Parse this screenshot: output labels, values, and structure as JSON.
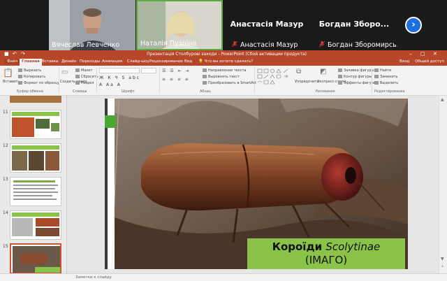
{
  "participants": [
    {
      "name": "Вячеслав Левченко",
      "video": true
    },
    {
      "name": "Наталія Пузріна",
      "video": true
    },
    {
      "name": "Анастасія Мазур",
      "video": false
    },
    {
      "name": "Богдан Збороми...",
      "full_name": "Богдан Збороми...",
      "video": false
    }
  ],
  "participants_display": {
    "p3_big": "Анастасія Мазур",
    "p3_small": "Анастасія Мазур",
    "p4_big": "Богдан Зборо...",
    "p4_small": "Богдан Зборомирсь..."
  },
  "window": {
    "title": "Презентація Столбурові заходи - PowerPoint (Сбой активации продукта)",
    "signin": "Вход",
    "share": "Общий доступ"
  },
  "tabs": [
    "Файл",
    "Главная",
    "Вставка",
    "Дизайн",
    "Переходы",
    "Анимация",
    "Слайд-шоу",
    "Рецензирование",
    "Вид"
  ],
  "tell_me": "Что вы хотите сделать?",
  "ribbon": {
    "paste": "Вставить",
    "cut": "Вырезать",
    "copy": "Копировать",
    "format_painter": "Формат по образцу",
    "clipboard_group": "Буфер обмена",
    "new_slide": "Создать слайд",
    "layout": "Макет",
    "reset": "Сбросить",
    "section": "Раздел",
    "slides_group": "Слайды",
    "font_group": "Шрифт",
    "text_direction": "Направление текста",
    "align_text": "Выровнять текст",
    "convert_smartart": "Преобразовать в SmartArt",
    "paragraph_group": "Абзац",
    "arrange": "Упорядочить",
    "quick_styles": "Экспресс-стили",
    "shape_fill": "Заливка фигуры",
    "shape_outline": "Контур фигуры",
    "shape_effects": "Эффекты фигуры",
    "drawing_group": "Рисование",
    "find": "Найти",
    "replace": "Заменить",
    "select": "Выделить",
    "editing_group": "Редактирование"
  },
  "thumbnails": [
    {
      "num": "11"
    },
    {
      "num": "12"
    },
    {
      "num": "13"
    },
    {
      "num": "14"
    },
    {
      "num": "15",
      "selected": true
    }
  ],
  "slide": {
    "caption_line1_bold": "Короїди",
    "caption_line1_italic": "Scolytinae",
    "caption_line2": "(ІМАГО)"
  },
  "notes_placeholder": "Заметки к слайду",
  "colors": {
    "ppt_accent": "#b7472a",
    "caption_green": "#8bc34a",
    "next_button": "#1e6fe0",
    "muted_mic": "#e53935"
  }
}
